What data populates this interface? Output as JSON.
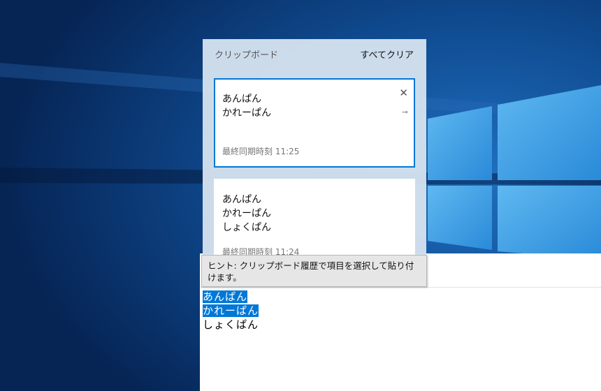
{
  "clipboard": {
    "title": "クリップボード",
    "clear_all": "すべてクリア",
    "items": [
      {
        "lines": [
          "あんぱん",
          "かれーぱん"
        ],
        "timestamp": "最終同期時刻 11:25"
      },
      {
        "lines": [
          "あんぱん",
          "かれーぱん",
          "しょくぱん"
        ],
        "timestamp": "最終同期時刻 11:24"
      }
    ]
  },
  "tooltip": "ヒント: クリップボード履歴で項目を選択して貼り付けます。",
  "editor": {
    "lines": [
      "あんぱん",
      "かれーぱん",
      "しょくぱん"
    ]
  },
  "colors": {
    "accent": "#0078d7"
  }
}
